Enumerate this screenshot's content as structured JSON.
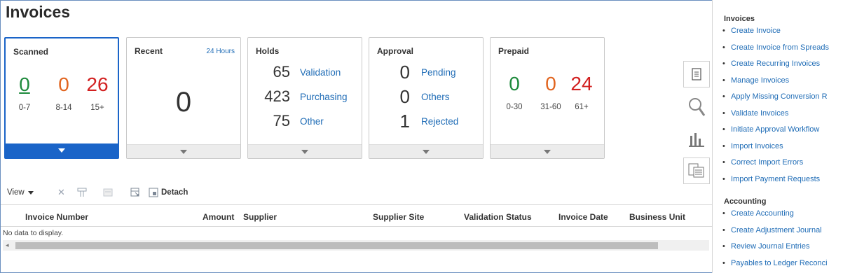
{
  "page": {
    "title": "Invoices"
  },
  "cards": {
    "scanned": {
      "title": "Scanned",
      "values": [
        "0",
        "0",
        "26"
      ],
      "labels": [
        "0-7",
        "8-14",
        "15+"
      ]
    },
    "recent": {
      "title": "Recent",
      "period": "24 Hours",
      "value": "0"
    },
    "holds": {
      "title": "Holds",
      "rows": [
        {
          "value": "65",
          "label": "Validation"
        },
        {
          "value": "423",
          "label": "Purchasing"
        },
        {
          "value": "75",
          "label": "Other"
        }
      ]
    },
    "approval": {
      "title": "Approval",
      "rows": [
        {
          "value": "0",
          "label": "Pending"
        },
        {
          "value": "0",
          "label": "Others"
        },
        {
          "value": "1",
          "label": "Rejected"
        }
      ]
    },
    "prepaid": {
      "title": "Prepaid",
      "values": [
        "0",
        "0",
        "24"
      ],
      "labels": [
        "0-30",
        "31-60",
        "61+"
      ]
    }
  },
  "toolbar": {
    "view_label": "View",
    "detach_label": "Detach"
  },
  "table": {
    "columns": [
      "Invoice Number",
      "Amount",
      "Supplier",
      "Supplier Site",
      "Validation Status",
      "Invoice Date",
      "Business Unit"
    ],
    "empty_text": "No data to display."
  },
  "tasks": {
    "invoices_title": "Invoices",
    "invoices": [
      "Create Invoice",
      "Create Invoice from Spreads",
      "Create Recurring Invoices",
      "Manage Invoices",
      "Apply Missing Conversion R",
      "Validate Invoices",
      "Initiate Approval Workflow",
      "Import Invoices",
      "Correct Import Errors",
      "Import Payment Requests"
    ],
    "accounting_title": "Accounting",
    "accounting": [
      "Create Accounting",
      "Create Adjustment Journal",
      "Review Journal Entries",
      "Payables to Ledger Reconci"
    ]
  },
  "colors": {
    "accent": "#1a64c8",
    "link": "#1f6cb6",
    "green": "#1e8a3c",
    "orange": "#e1641e",
    "red": "#d22020"
  },
  "icons": [
    "tasks-icon",
    "search-icon",
    "reports-icon",
    "scan-documents-icon"
  ]
}
